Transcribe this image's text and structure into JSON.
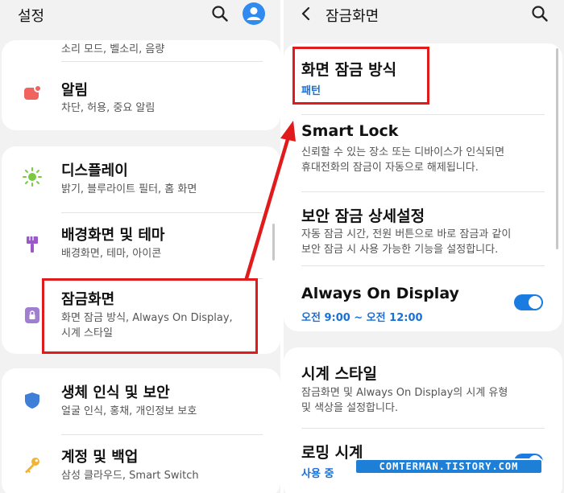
{
  "left": {
    "title": "설정",
    "partial_top_item": "소리 모드, 벨소리, 음량",
    "items": [
      {
        "icon": "bell-icon",
        "title": "알림",
        "subtitle": "차단, 허용, 중요 알림"
      },
      {
        "icon": "brightness-icon",
        "title": "디스플레이",
        "subtitle": "밝기, 블루라이트 필터, 홈 화면"
      },
      {
        "icon": "paintbrush-icon",
        "title": "배경화면 및 테마",
        "subtitle": "배경화면, 테마, 아이콘"
      },
      {
        "icon": "lock-screen-icon",
        "title": "잠금화면",
        "subtitle": "화면 잠금 방식, Always On Display,",
        "subtitle2": "시계 스타일"
      },
      {
        "icon": "shield-icon",
        "title": "생체 인식 및 보안",
        "subtitle": "얼굴 인식, 홍채, 개인정보 보호"
      },
      {
        "icon": "key-icon",
        "title": "계정 및 백업",
        "subtitle": "삼성 클라우드, Smart Switch"
      }
    ]
  },
  "right": {
    "back_icon": "back-arrow-icon",
    "title": "잠금화면",
    "items": [
      {
        "title": "화면 잠금 방식",
        "value": "패턴"
      },
      {
        "title": "Smart Lock",
        "desc1": "신뢰할 수 있는 장소 또는 디바이스가 인식되면",
        "desc2": "휴대전화의 잠금이 자동으로 해제됩니다."
      },
      {
        "title": "보안 잠금 상세설정",
        "desc1": "자동 잠금 시간, 전원 버튼으로 바로 잠금과 같이",
        "desc2": "보안 잠금 시 사용 가능한 기능을 설정합니다."
      },
      {
        "title": "Always On Display",
        "value": "오전 9:00 ~ 오전 12:00",
        "toggle": true
      },
      {
        "title": "시계 스타일",
        "desc1": "잠금화면 및 Always On Display의 시계 유형",
        "desc2": "및 색상을 설정합니다."
      },
      {
        "title": "로밍 시계",
        "value": "사용 중",
        "toggle": true
      }
    ]
  },
  "annotation": {
    "color": "#e11b1b"
  },
  "accent": "#1a6fd8",
  "watermark": "COMTERMAN.TISTORY.COM"
}
